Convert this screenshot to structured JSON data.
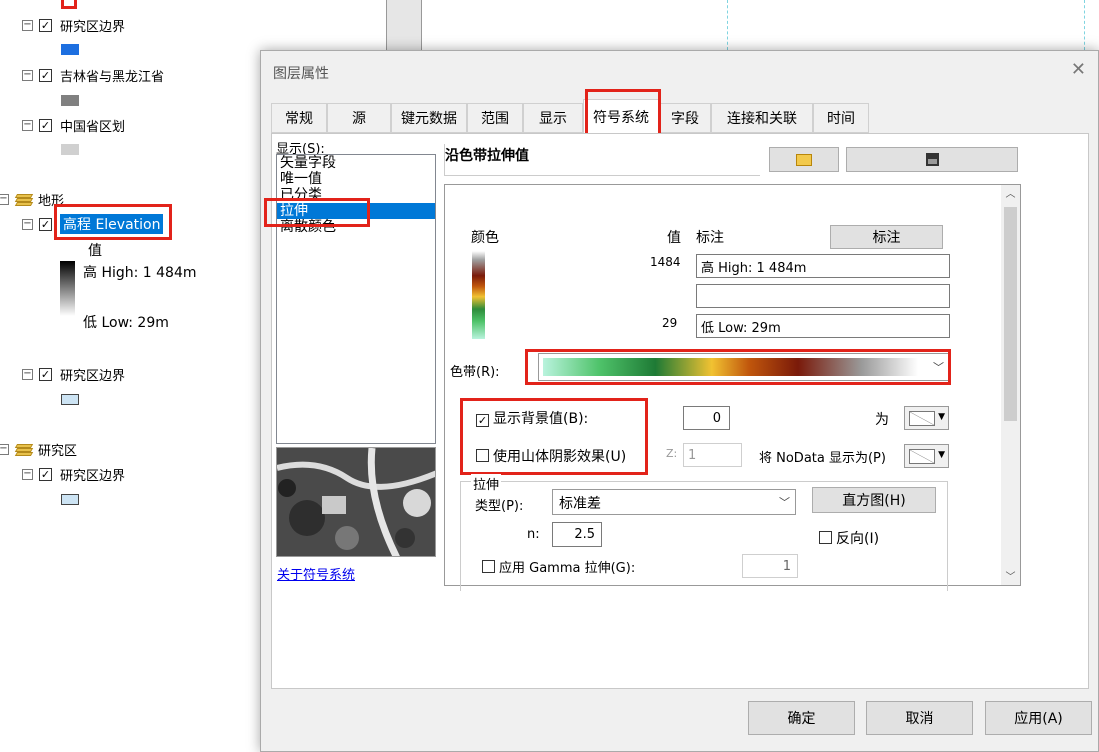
{
  "toc": {
    "items": [
      {
        "label": "研究区边界",
        "swatch": "#1d6fe0"
      },
      {
        "label": "吉林省与黑龙江省",
        "swatch": "#808080"
      },
      {
        "label": "中国省区划",
        "swatch": "#d0d0d0"
      }
    ],
    "group_terrain": {
      "label": "地形",
      "layer_label": "高程 Elevation",
      "legend_value_heading": "值",
      "legend_high": "高 High: 1 484m",
      "legend_low": "低 Low: 29m",
      "boundary_label": "研究区边界"
    },
    "group_study": {
      "label": "研究区",
      "boundary_label": "研究区边界"
    }
  },
  "dialog": {
    "title": "图层属性",
    "tabs": [
      "常规",
      "源",
      "键元数据",
      "范围",
      "显示",
      "符号系统",
      "字段",
      "连接和关联",
      "时间"
    ],
    "active_tab": "符号系统",
    "show_label": "显示(S):",
    "show_options": [
      "矢量字段",
      "唯一值",
      "已分类",
      "拉伸",
      "离散颜色"
    ],
    "selected_show": "拉伸",
    "about_link": "关于符号系统",
    "panel_title": "沿色带拉伸值",
    "col_color": "颜色",
    "col_value": "值",
    "col_label": "标注",
    "label_button": "标注",
    "high_value": "1484",
    "high_label": "高 High: 1 484m",
    "mid_label": "",
    "low_value": "29",
    "low_label": "低 Low: 29m",
    "color_ramp_label": "色带(R):",
    "show_bg_label": "显示背景值(B):",
    "bg_value": "0",
    "as_label": "为",
    "hillshade_label": "使用山体阴影效果(U)",
    "z_label": "Z:",
    "z_value": "1",
    "nodata_label": "将 NoData 显示为(P)",
    "stretch_group": "拉伸",
    "type_label": "类型(P):",
    "type_value": "标准差",
    "histogram_button": "直方图(H)",
    "n_label": "n:",
    "n_value": "2.5",
    "invert_label": "反向(I)",
    "gamma_label": "应用 Gamma 拉伸(G):",
    "gamma_value": "1",
    "ok_button": "确定",
    "cancel_button": "取消",
    "apply_button": "应用(A)"
  },
  "colors": {
    "highlight_red": "#e2231a",
    "selection_blue": "#0078d7",
    "link_blue": "#0000ee"
  }
}
